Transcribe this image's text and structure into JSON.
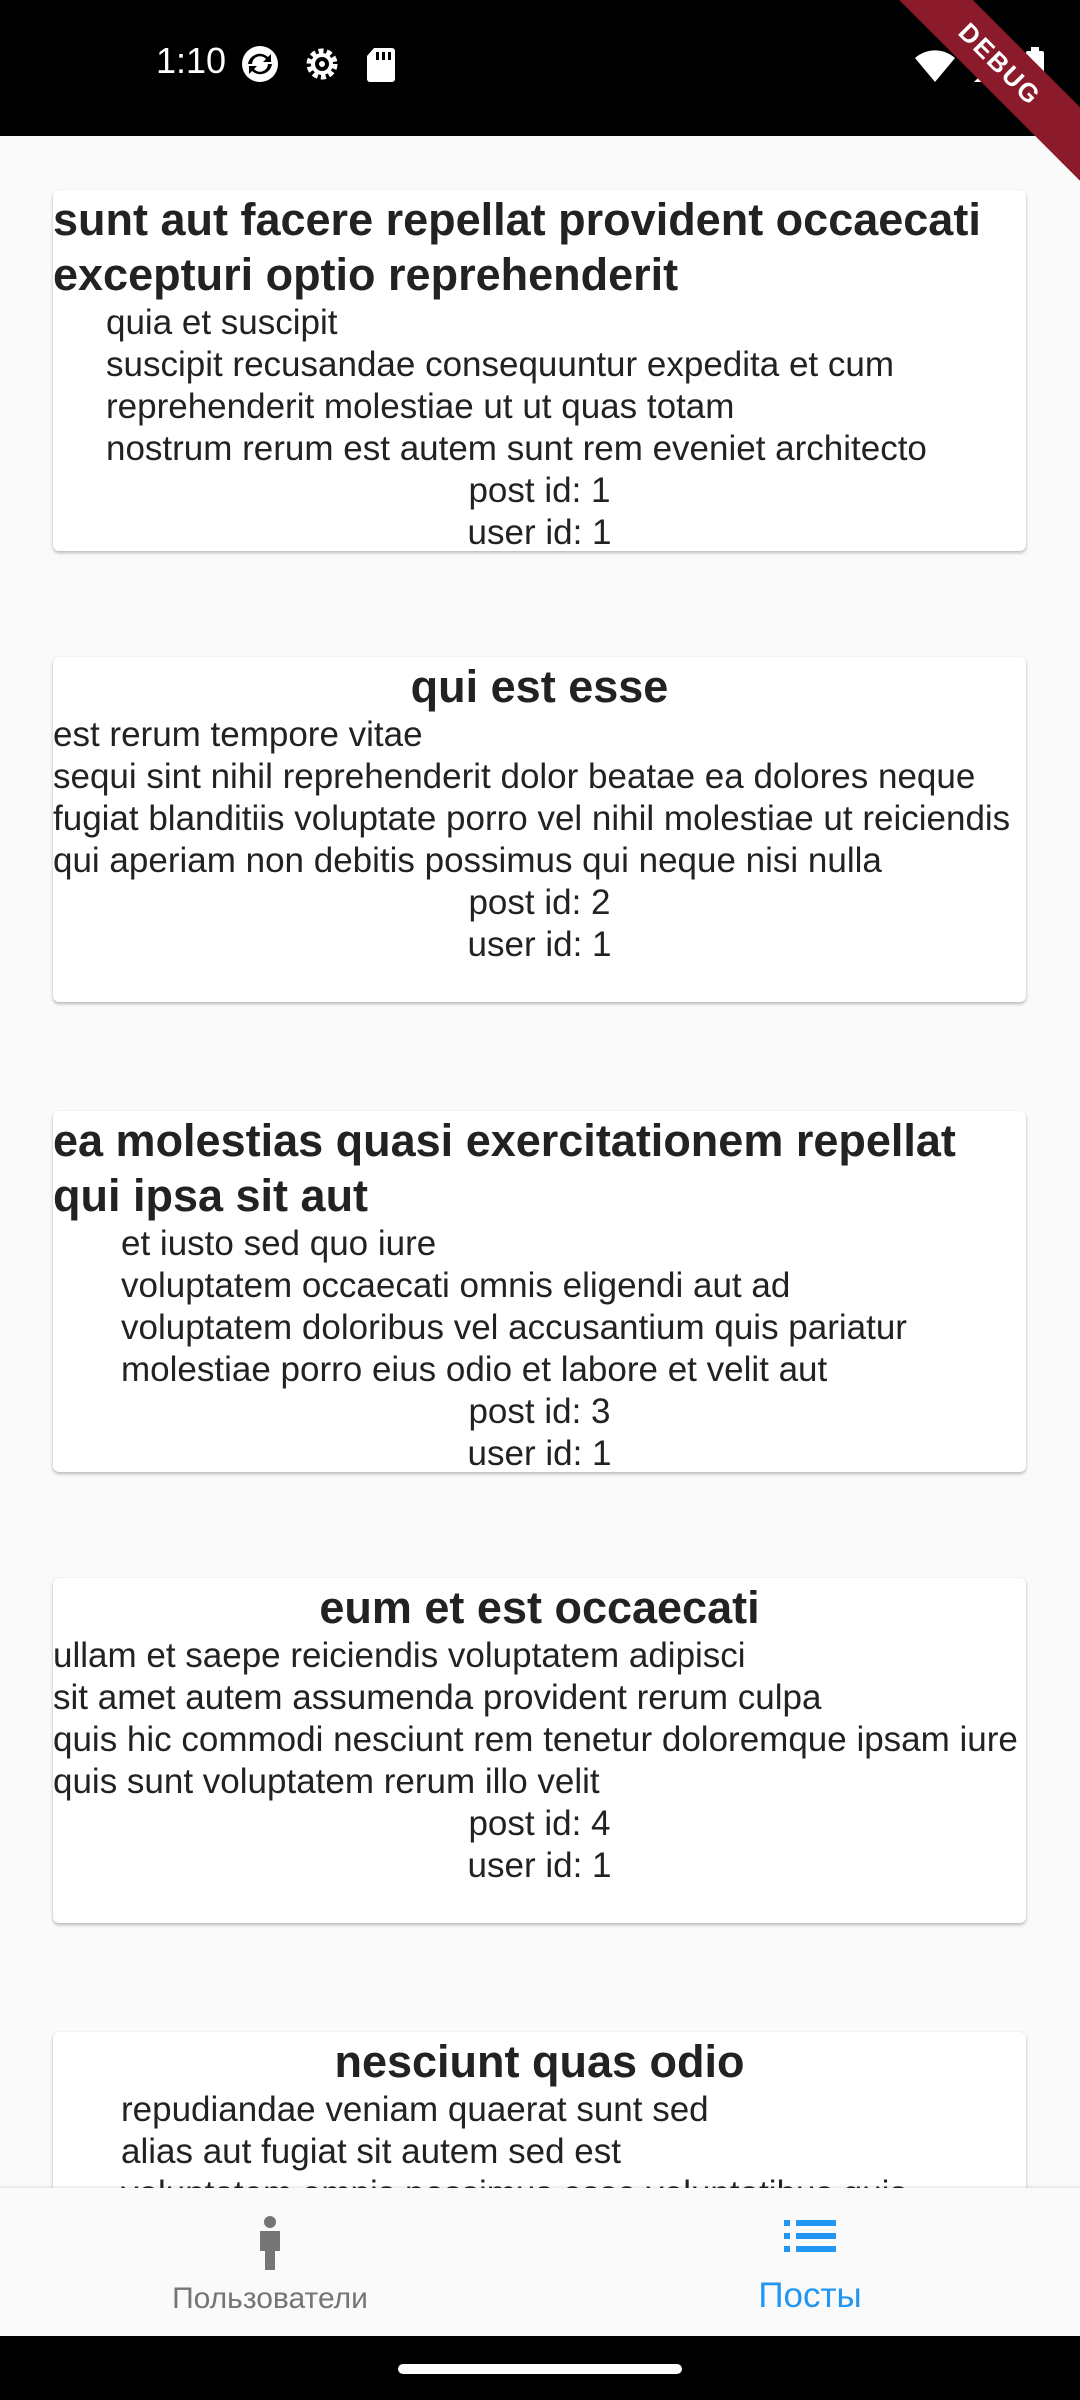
{
  "status_bar": {
    "time": "1:10",
    "icons_left": [
      "sync-icon",
      "gear-icon",
      "sd-card-icon"
    ],
    "icons_right": [
      "wifi-icon",
      "signal-icon",
      "battery-icon"
    ],
    "debug_label": "DEBUG"
  },
  "posts": [
    {
      "title": "sunt aut facere repellat provident occaecati excepturi optio reprehenderit",
      "body": "quia et suscipit\nsuscipit recusandae consequuntur expedita et cum\nreprehenderit molestiae ut ut quas totam\nnostrum rerum est autem sunt rem eveniet architecto",
      "post_id": "post id: 1",
      "user_id": "user id: 1"
    },
    {
      "title": "qui est esse",
      "body": "est rerum tempore vitae\nsequi sint nihil reprehenderit dolor beatae ea dolores neque\nfugiat blanditiis voluptate porro vel nihil molestiae ut reiciendis\nqui aperiam non debitis possimus qui neque nisi nulla",
      "post_id": "post id: 2",
      "user_id": "user id: 1"
    },
    {
      "title": "ea molestias quasi exercitationem repellat qui ipsa sit aut",
      "body": "et iusto sed quo iure\nvoluptatem occaecati omnis eligendi aut ad\nvoluptatem doloribus vel accusantium quis pariatur\nmolestiae porro eius odio et labore et velit aut",
      "post_id": "post id: 3",
      "user_id": "user id: 1"
    },
    {
      "title": "eum et est occaecati",
      "body": "ullam et saepe reiciendis voluptatem adipisci\nsit amet autem assumenda provident rerum culpa\nquis hic commodi nesciunt rem tenetur doloremque ipsam iure\nquis sunt voluptatem rerum illo velit",
      "post_id": "post id: 4",
      "user_id": "user id: 1"
    },
    {
      "title": "nesciunt quas odio",
      "body": "repudiandae veniam quaerat sunt sed\nalias aut fugiat sit autem sed est\nvoluptatem omnis possimus esse voluptatibus quis",
      "post_id": "",
      "user_id": ""
    }
  ],
  "bottom_nav": {
    "items": [
      {
        "label": "Пользователи",
        "icon": "person-icon",
        "active": false
      },
      {
        "label": "Посты",
        "icon": "list-icon",
        "active": true
      }
    ],
    "active_color": "#2196f3",
    "inactive_color": "#757575"
  }
}
